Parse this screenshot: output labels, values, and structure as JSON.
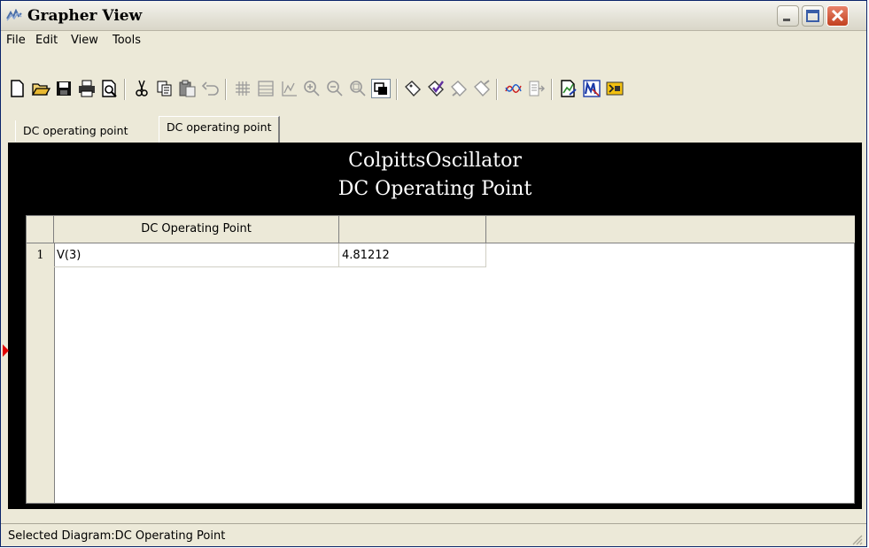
{
  "window": {
    "title": "Grapher View"
  },
  "menu": [
    {
      "label": "File"
    },
    {
      "label": "Edit"
    },
    {
      "label": "View"
    },
    {
      "label": "Tools"
    }
  ],
  "toolbar": {
    "icons": [
      "new-icon",
      "open-icon",
      "save-icon",
      "print-icon",
      "print-preview-icon",
      "cut-icon",
      "copy-icon",
      "paste-icon",
      "undo-icon",
      "grid-icon",
      "table-icon",
      "axis-icon",
      "zoom-in-icon",
      "zoom-out-icon",
      "zoom-fit-icon",
      "overlay-icon",
      "cursor-tag-icon",
      "cursor-check-icon",
      "cursor-prev-icon",
      "cursor-next-icon",
      "curve-icon",
      "export-icon",
      "export-chart-icon",
      "mathcad-icon",
      "labview-icon"
    ]
  },
  "tabs": [
    {
      "label": "DC operating point",
      "active": false
    },
    {
      "label": "DC operating point",
      "active": true
    }
  ],
  "chart": {
    "title_line1": "ColpittsOscillator",
    "title_line2": "DC Operating Point"
  },
  "table": {
    "columns": [
      "DC Operating Point",
      ""
    ],
    "rows": [
      {
        "num": "1",
        "name": "V(3)",
        "value": "4.81212"
      }
    ]
  },
  "status": {
    "text": "Selected Diagram:DC Operating Point"
  },
  "colors": {
    "title_bar_close": "#c2401f",
    "panel_bg": "#000000",
    "marker": "#e00000"
  }
}
